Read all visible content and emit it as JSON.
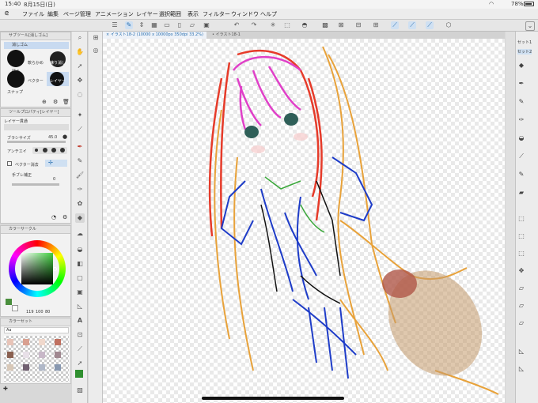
{
  "status_bar": {
    "time": "15:40",
    "date": "8月15日(日)",
    "battery": "78%"
  },
  "menu": {
    "items": [
      "ファイル",
      "編集",
      "ページ管理",
      "アニメーション",
      "レイヤー",
      "選択範囲",
      "表示",
      "フィルター",
      "ウィンドウ",
      "ヘルプ"
    ]
  },
  "document": {
    "tab_active": "イラスト18-2 (10000 x 10000px 350dpi 33.2%)",
    "tab_inactive": "イラスト18-1"
  },
  "subtool_panel": {
    "title": "サブツール[消しゴム]",
    "group": "消しゴム",
    "items": [
      "硬め",
      "軟らかめ",
      "練り消し",
      "ベクター",
      "レイヤー",
      "スナップ"
    ]
  },
  "tool_property": {
    "title": "ツールプロパティ[レイヤー]",
    "name": "レイヤー貫通",
    "brush_size_label": "ブラシサイズ",
    "brush_size_value": "45.0",
    "antialias_label": "アンチエイ",
    "vector_label": "ベクター消去",
    "stabilization_label": "手ブレ補正",
    "stabilization_value": "0"
  },
  "color_circle": {
    "title": "カラーサークル",
    "rgb_r": "119",
    "rgb_g": "100",
    "rgb_b": "80",
    "selected_color": "#4a8f3d",
    "sub_color": "#ffffff"
  },
  "color_set": {
    "title": "カラーセット",
    "dropdown": "Aa",
    "swatches": [
      "#e8c4b8",
      "#d9a090",
      "#f0d8cc",
      "#c07060",
      "#8a6050",
      "#e8e0e8",
      "#c8b8c8",
      "#a08890",
      "#d8c8b8",
      "#706070",
      "#b0b8c8",
      "#8898b0"
    ]
  },
  "colors": {
    "accent": "#2a6fb0",
    "canvas_bg": "#ffffff",
    "panel_bg": "#f2f2f2"
  }
}
